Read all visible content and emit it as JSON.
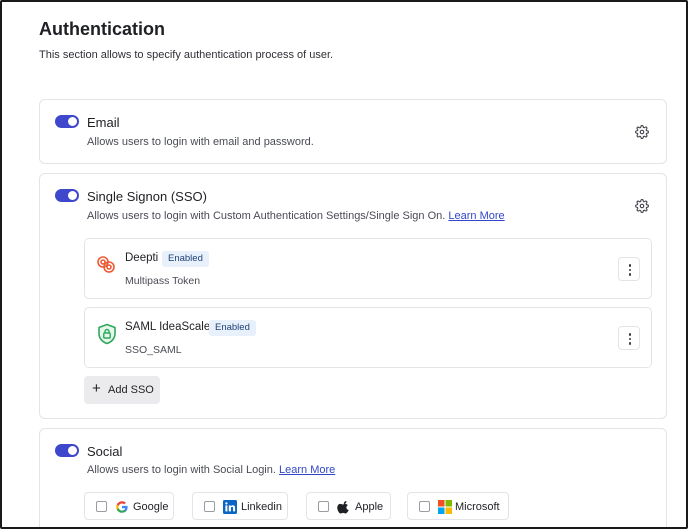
{
  "header": {
    "title": "Authentication",
    "description": "This section allows to specify authentication process of user."
  },
  "email": {
    "enabled": true,
    "title": "Email",
    "description": "Allows users to login with email and password.",
    "settings_icon": "gear-icon"
  },
  "sso": {
    "enabled": true,
    "title": "Single Signon (SSO)",
    "description": "Allows users to login with Custom Authentication Settings/Single Sign On.",
    "learn_more": "Learn More",
    "settings_icon": "gear-icon",
    "providers": [
      {
        "name": "Deepti",
        "status": "Enabled",
        "type": "Multipass Token",
        "icon": "multipass-rings-icon"
      },
      {
        "name": "SAML IdeaScale",
        "status": "Enabled",
        "type": "SSO_SAML",
        "icon": "shield-lock-icon"
      }
    ],
    "add_label": "Add SSO"
  },
  "social": {
    "enabled": true,
    "title": "Social",
    "description": "Allows users to login with Social Login.",
    "learn_more": "Learn More",
    "options": [
      {
        "label": "Google",
        "checked": false,
        "icon": "google-icon"
      },
      {
        "label": "Linkedin",
        "checked": false,
        "icon": "linkedin-icon"
      },
      {
        "label": "Apple",
        "checked": false,
        "icon": "apple-icon"
      },
      {
        "label": "Microsoft",
        "checked": false,
        "icon": "microsoft-icon"
      }
    ]
  },
  "colors": {
    "toggle_on": "#3f48cc",
    "link": "#3247c8",
    "badge_bg": "#e8f0fb",
    "badge_text": "#1e3f77"
  }
}
